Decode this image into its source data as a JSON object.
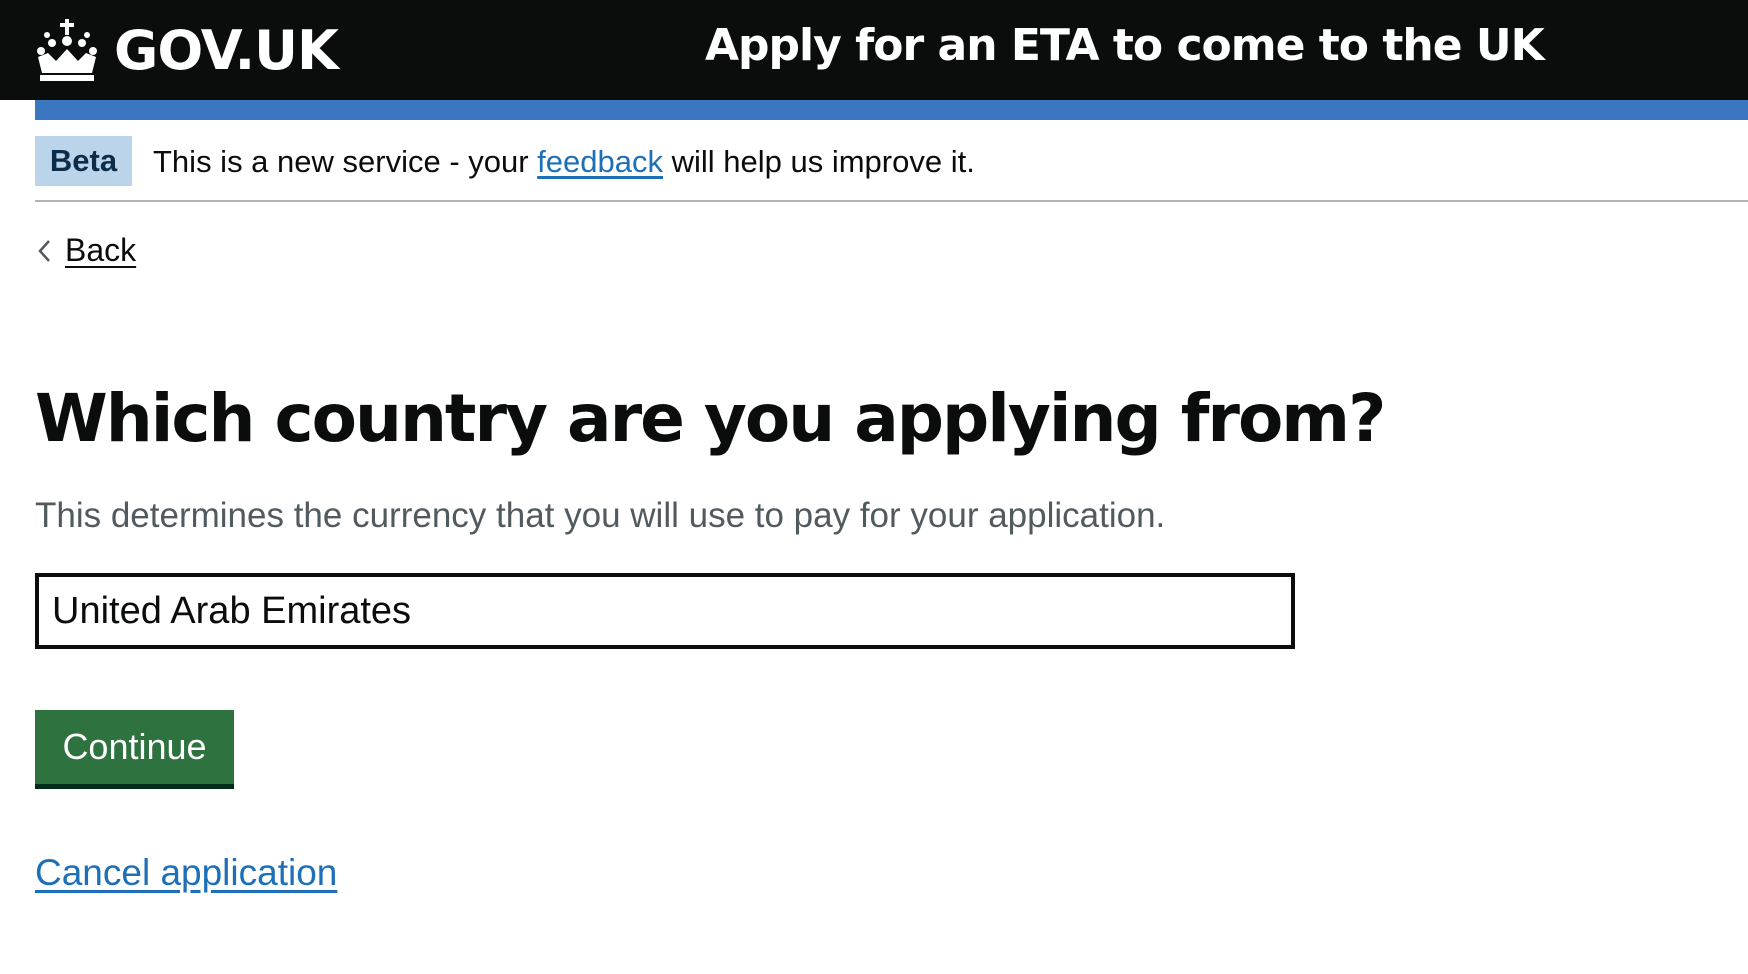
{
  "header": {
    "logo_text": "GOV.UK",
    "logo_icon": "crown-icon",
    "service_name": "Apply for an ETA to come to the UK"
  },
  "phase_banner": {
    "tag": "Beta",
    "text_before": "This is a new service - your ",
    "link_text": "feedback",
    "text_after": " will help us improve it."
  },
  "nav": {
    "back_label": "Back",
    "back_icon": "chevron-left-icon"
  },
  "main": {
    "title": "Which country are you applying from?",
    "hint": "This determines the currency that you will use to pay for your application.",
    "country_input_value": "United Arab Emirates",
    "continue_label": "Continue",
    "cancel_label": "Cancel application"
  },
  "colors": {
    "header_bg": "#0b0c0c",
    "brand_blue": "#3a77c0",
    "link": "#1d70b8",
    "button_green": "#2e7240",
    "hint_grey": "#505a5f"
  }
}
